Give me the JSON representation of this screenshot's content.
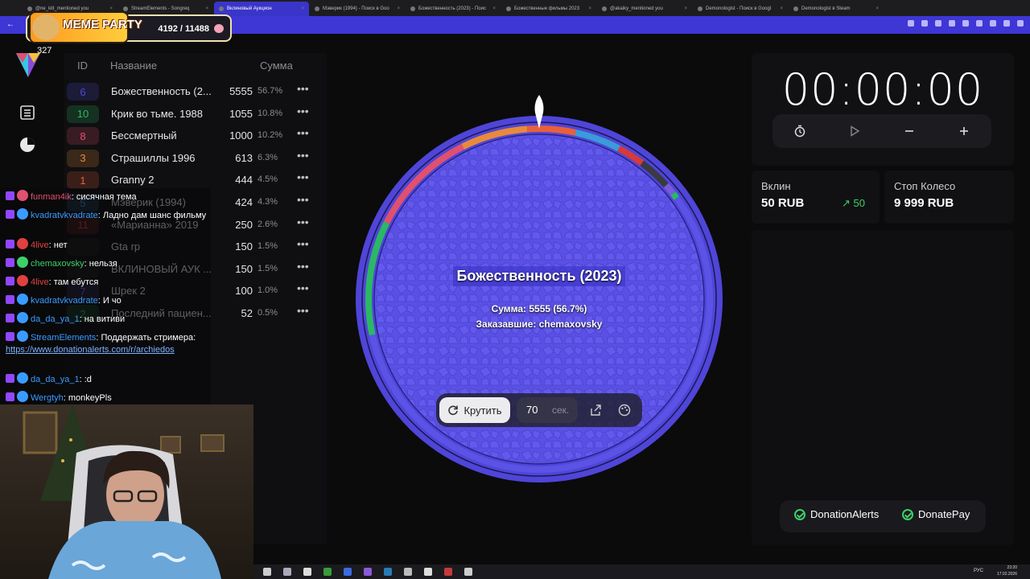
{
  "browser": {
    "tabs": [
      {
        "title": "@ne_kilt_mentioned you",
        "active": false
      },
      {
        "title": "StreamElements - Songreq",
        "active": false
      },
      {
        "title": "Вклиновый Аукцион",
        "active": true
      },
      {
        "title": "Мэверик (1994) - Поиск в Goo",
        "active": false
      },
      {
        "title": "Божественность (2023) - Поис",
        "active": false
      },
      {
        "title": "Божественные фильмы 2023",
        "active": false
      },
      {
        "title": "@akaiky_mentioned you",
        "active": false
      },
      {
        "title": "Demonologist - Поиск в Googl",
        "active": false
      },
      {
        "title": "Demonologist в Steam",
        "active": false
      }
    ],
    "accent_color": "#3f36d6"
  },
  "overlay": {
    "meme_title": "MEME PARTY",
    "meme_count": "4192 / 11488",
    "viewer_count": "327"
  },
  "table": {
    "headers": {
      "id": "ID",
      "name": "Название",
      "sum": "Сумма"
    },
    "rows": [
      {
        "id": "6",
        "name": "Божественность (2...",
        "sum": "5555",
        "pct": "56.7%",
        "color": "#4f49d8"
      },
      {
        "id": "10",
        "name": "Крик во тьме. 1988",
        "sum": "1055",
        "pct": "10.8%",
        "color": "#2bb864"
      },
      {
        "id": "8",
        "name": "Бессмертный",
        "sum": "1000",
        "pct": "10.2%",
        "color": "#e0506f"
      },
      {
        "id": "3",
        "name": "Страшиллы 1996",
        "sum": "613",
        "pct": "6.3%",
        "color": "#e88a3c"
      },
      {
        "id": "1",
        "name": "Granny 2",
        "sum": "444",
        "pct": "4.5%",
        "color": "#e8603c"
      },
      {
        "id": "5",
        "name": "Мэверик (1994)",
        "sum": "424",
        "pct": "4.3%",
        "color": "#3a9bd8"
      },
      {
        "id": "11",
        "name": "«Марианна» 2019",
        "sum": "250",
        "pct": "2.6%",
        "color": "#d63a3a"
      },
      {
        "id": "",
        "name": "Gta rp",
        "sum": "150",
        "pct": "1.5%",
        "color": "#3a3a40"
      },
      {
        "id": "",
        "name": "ВКЛИНОВЫЙ АУК ...",
        "sum": "150",
        "pct": "1.5%",
        "color": "#3a3a40"
      },
      {
        "id": "7",
        "name": "Шрек 2",
        "sum": "100",
        "pct": "1.0%",
        "color": "#7a5ad8"
      },
      {
        "id": "2",
        "name": "Последний пациен...",
        "sum": "52",
        "pct": "0.5%",
        "color": "#2bb864"
      }
    ],
    "more_glyph": "•••"
  },
  "chat": [
    {
      "user": "funman4ik",
      "user_color": "#e0506f",
      "text": "сисячная тема"
    },
    {
      "user": "kvadratvkvadrate",
      "user_color": "#3a9bff",
      "text": "Ладно дам шанс фильму"
    },
    {
      "user": "4live",
      "user_color": "#e04040",
      "text": "нет"
    },
    {
      "user": "chemaxovsky",
      "user_color": "#3ecf6a",
      "text": "нельзя"
    },
    {
      "user": "4live",
      "user_color": "#e04040",
      "text": "там ебутся"
    },
    {
      "user": "kvadratvkvadrate",
      "user_color": "#3a9bff",
      "text": "И чо"
    },
    {
      "user": "da_da_ya_1",
      "user_color": "#3a9bff",
      "text": "на витиви"
    },
    {
      "user": "StreamElements",
      "user_color": "#3a9bff",
      "text": "Поддержать стримера:",
      "link": "https://www.donationalerts.com/r/archiedos"
    },
    {
      "user": "da_da_ya_1",
      "user_color": "#3a9bff",
      "text": ":d"
    },
    {
      "user": "Wergtyh",
      "user_color": "#3a9bff",
      "text": "monkeyPls"
    }
  ],
  "wheel": {
    "title": "Божественность (2023)",
    "sum_text": "Сумма: 5555 (56.7%)",
    "ordered_text": "Заказавшие: chemaxovsky",
    "spin_label": "Крутить",
    "seconds_value": "70",
    "seconds_unit": "сек.",
    "color": "#5b52e6"
  },
  "timer": {
    "value": "00:00:00"
  },
  "stats": {
    "vklin_label": "Вклин",
    "vklin_value": "50 RUB",
    "vklin_trend": "50",
    "stop_label": "Стоп Колесо",
    "stop_value": "9 999 RUB"
  },
  "payments": [
    {
      "name": "DonationAlerts",
      "status_color": "#3ecf6a"
    },
    {
      "name": "DonatePay",
      "status_color": "#3ecf6a"
    }
  ],
  "taskbar": {
    "lang": "РУС",
    "time": "23:20",
    "date": "17.02.2026"
  }
}
